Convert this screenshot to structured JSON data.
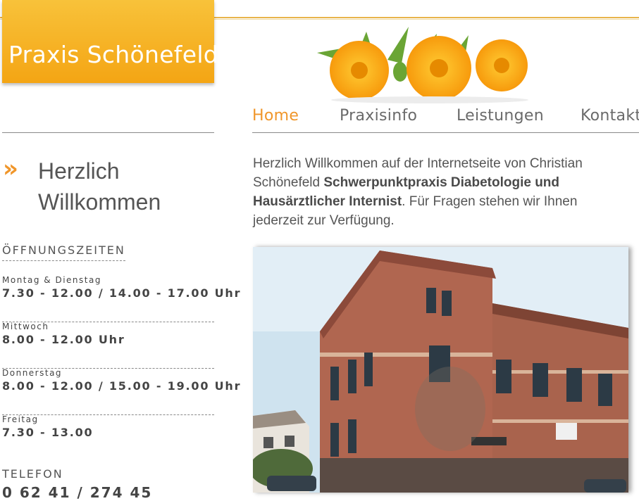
{
  "header": {
    "logo_text": "Praxis Schönefeld"
  },
  "nav": {
    "items": [
      {
        "label": "Home",
        "active": true
      },
      {
        "label": "Praxisinfo",
        "active": false
      },
      {
        "label": "Leistungen",
        "active": false
      },
      {
        "label": "Kontakt",
        "active": false
      }
    ]
  },
  "sidebar": {
    "welcome_arrow": "»",
    "welcome_title": "Herzlich Willkommen",
    "opening_heading": "ÖFFNUNGSZEITEN",
    "hours": [
      {
        "day": "Montag & Dienstag",
        "time": "7.30 - 12.00 / 14.00 - 17.00 Uhr"
      },
      {
        "day": "Mittwoch",
        "time": "8.00 - 12.00 Uhr"
      },
      {
        "day": "Donnerstag",
        "time": "8.00 - 12.00 / 15.00 - 19.00 Uhr"
      },
      {
        "day": "Freitag",
        "time": "7.30 - 13.00"
      }
    ],
    "phone_heading": "TELEFON",
    "phone_value": "0 62 41 / 274 45"
  },
  "main": {
    "intro_part1": "Herzlich Willkommen auf der Internetseite von Christian Schönefeld ",
    "intro_bold": "Schwerpunktpraxis Diabetologie und Hausärztlicher Internist",
    "intro_part2": ". Für Fragen stehen wir Ihnen jederzeit zur Verfügung."
  },
  "colors": {
    "accent": "#f0962a",
    "logo_bg": "#f4a514"
  }
}
